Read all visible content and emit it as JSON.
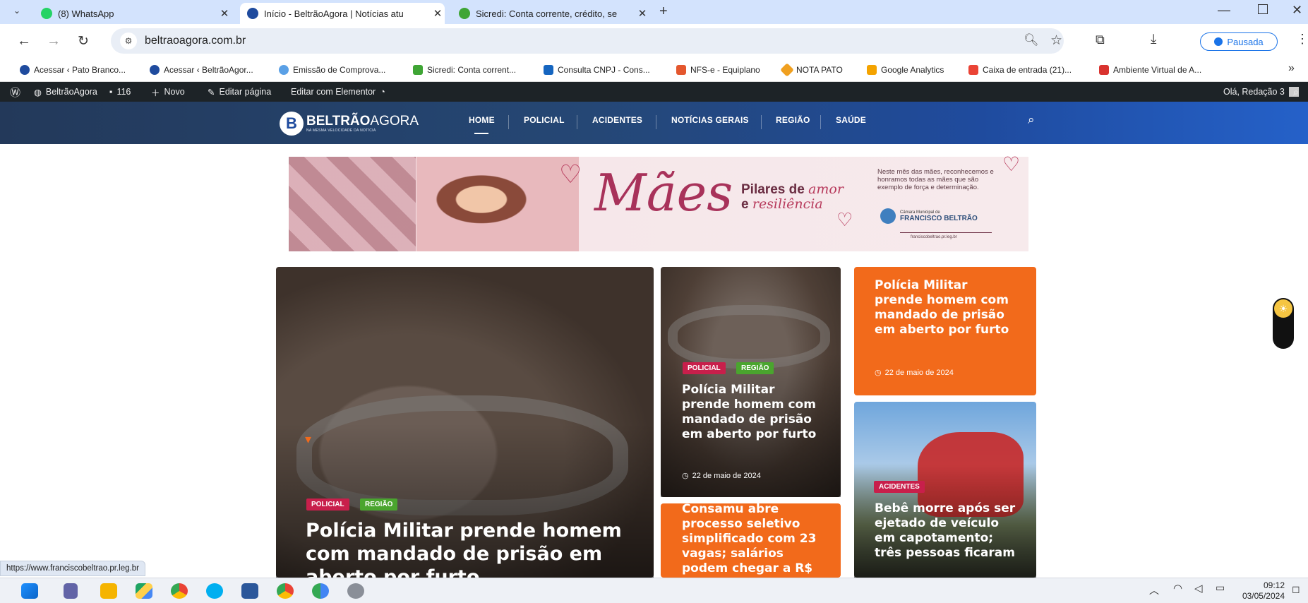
{
  "browser": {
    "tabs": [
      {
        "label": "(8) WhatsApp",
        "close": "✕"
      },
      {
        "label": "Início - BeltrãoAgora | Notícias atu",
        "close": "✕"
      },
      {
        "label": "Sicredi: Conta corrente, crédito, se",
        "close": "✕"
      }
    ],
    "new_tab": "+",
    "url": "beltraoagora.com.br",
    "paused_label": "Pausada",
    "bookmarks": [
      "Acessar ‹ Pato Branco...",
      "Acessar ‹ BeltrãoAgor...",
      "Emissão de Comprova...",
      "Sicredi: Conta corrent...",
      "Consulta CNPJ - Cons...",
      "NFS-e - Equiplano",
      "NOTA PATO",
      "Google Analytics",
      "Caixa de entrada (21)...",
      "Ambiente Virtual de A..."
    ],
    "status_url": "https://www.franciscobeltrao.pr.leg.br"
  },
  "wpbar": {
    "site": "BeltrãoAgora",
    "comments": "116",
    "new": "Novo",
    "edit": "Editar página",
    "elementor": "Editar com Elementor",
    "greeting": "Olá, Redação 3"
  },
  "site": {
    "logo_main": "BELTRÃO",
    "logo_sub": "AGORA",
    "tagline": "NA MESMA VELOCIDADE DA NOTÍCIA",
    "nav": [
      "HOME",
      "POLICIAL",
      "ACIDENTES",
      "NOTÍCIAS GERAIS",
      "REGIÃO",
      "SAÚDE"
    ]
  },
  "banner": {
    "big": "Mães",
    "pilares": "Pilares de",
    "amor": "amor",
    "e": "e",
    "resiliencia": "resiliência",
    "text": "Neste mês das mães, reconhecemos e honramos todas as mães que são exemplo de força e determinação.",
    "org_small": "Câmara Municipal de",
    "org": "FRANCISCO BELTRÃO",
    "org_url": "franciscobeltrao.pr.leg.br"
  },
  "cards": {
    "main": {
      "tag1": "POLICIAL",
      "tag2": "REGIÃO",
      "title": "Polícia Militar prende homem com mandado de prisão em aberto por furto"
    },
    "mid": {
      "tag1": "POLICIAL",
      "tag2": "REGIÃO",
      "title": "Polícia Militar prende homem com mandado de prisão em aberto por furto",
      "date": "22 de maio de 2024"
    },
    "mid2": {
      "title": "Consamu abre processo seletivo simplificado com 23 vagas; salários podem chegar a R$"
    },
    "right_top": {
      "title": "Polícia Militar prende homem com mandado de prisão em aberto por furto",
      "date": "22 de maio de 2024"
    },
    "right_bottom": {
      "tag": "ACIDENTES",
      "title": "Bebê morre após ser ejetado de veículo em capotamento; três pessoas ficaram"
    }
  },
  "taskbar": {
    "time": "09:12",
    "date": "03/05/2024"
  },
  "colors": {
    "accent_orange": "#f26a1b",
    "nav_blue": "#1f4b9e",
    "tag_red": "#c81f4b",
    "tag_green": "#4aa52e"
  }
}
